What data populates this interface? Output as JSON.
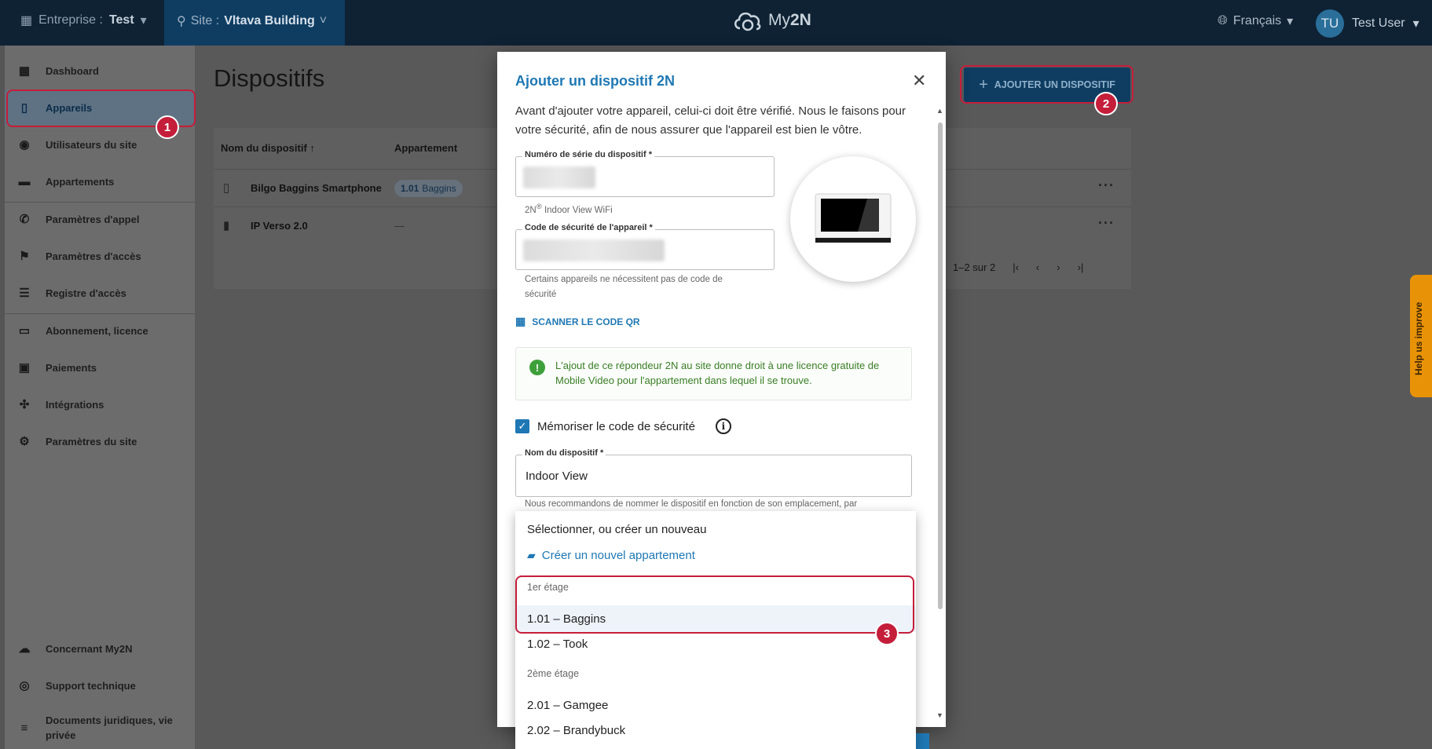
{
  "header": {
    "enterprise_label": "Entreprise :",
    "enterprise_value": "Test",
    "site_label": "Site :",
    "site_value": "Vltava Building",
    "logo_text_a": "My",
    "logo_text_b": "2N",
    "language": "Français",
    "user_initials": "TU",
    "user_name": "Test User"
  },
  "sidebar": {
    "items": [
      {
        "label": "Dashboard",
        "icon": "dashboard-icon"
      },
      {
        "label": "Appareils",
        "icon": "devices-icon"
      },
      {
        "label": "Utilisateurs du site",
        "icon": "users-icon"
      },
      {
        "label": "Appartements",
        "icon": "apartments-icon"
      },
      {
        "label": "Paramètres d'appel",
        "icon": "phone-settings-icon"
      },
      {
        "label": "Paramètres d'accès",
        "icon": "access-icon"
      },
      {
        "label": "Registre d'accès",
        "icon": "list-icon"
      },
      {
        "label": "Abonnement, licence",
        "icon": "card-icon"
      },
      {
        "label": "Paiements",
        "icon": "payments-icon"
      },
      {
        "label": "Intégrations",
        "icon": "integrations-icon"
      },
      {
        "label": "Paramètres du site",
        "icon": "gear-icon"
      }
    ],
    "footer": [
      {
        "label": "Concernant My2N"
      },
      {
        "label": "Support technique"
      },
      {
        "label": "Documents juridiques, vie privée"
      }
    ]
  },
  "main": {
    "title": "Dispositifs",
    "add_button": "AJOUTER UN DISPOSITIF",
    "table": {
      "headers": [
        "Nom du dispositif",
        "Appartement"
      ],
      "rows": [
        {
          "name": "Bilgo Baggins Smartphone",
          "apt_num": "1.01",
          "apt_name": "Baggins"
        },
        {
          "name": "IP Verso 2.0",
          "apt_num": "—",
          "apt_name": ""
        }
      ],
      "pagination": "1–2 sur 2"
    }
  },
  "help_tab": "Help us improve",
  "dialog": {
    "title": "Ajouter un dispositif 2N",
    "intro": "Avant d'ajouter votre appareil, celui-ci doit être vérifié. Nous le faisons pour votre sécurité, afin de nous assurer que l'appareil est bien le vôtre.",
    "serial_label": "Numéro de série du dispositif *",
    "serial_hint_a": "2N",
    "serial_hint_b": "Indoor View WiFi",
    "code_label": "Code de sécurité de l'appareil *",
    "code_hint": "Certains appareils ne nécessitent pas de code de sécurité",
    "scan_qr": "SCANNER LE CODE QR",
    "info_text": "L'ajout de ce répondeur 2N au site donne droit à une licence gratuite de Mobile Video pour l'appartement dans lequel il se trouve.",
    "remember_label": "Mémoriser le code de sécurité",
    "name_label": "Nom du dispositif *",
    "name_value": "Indoor View",
    "name_hint": "Nous recommandons de nommer le dispositif en fonction de son emplacement, par"
  },
  "dropdown": {
    "placeholder": "Sélectionner, ou créer un nouveau",
    "create": "Créer un nouvel appartement",
    "groups": [
      {
        "label": "1er étage",
        "items": [
          "1.01 – Baggins",
          "1.02 – Took"
        ]
      },
      {
        "label": "2ème étage",
        "items": [
          "2.01 – Gamgee",
          "2.02 – Brandybuck"
        ]
      }
    ]
  },
  "annotations": {
    "badge1": "1",
    "badge2": "2",
    "badge3": "3",
    "color": "#c41e3a"
  }
}
